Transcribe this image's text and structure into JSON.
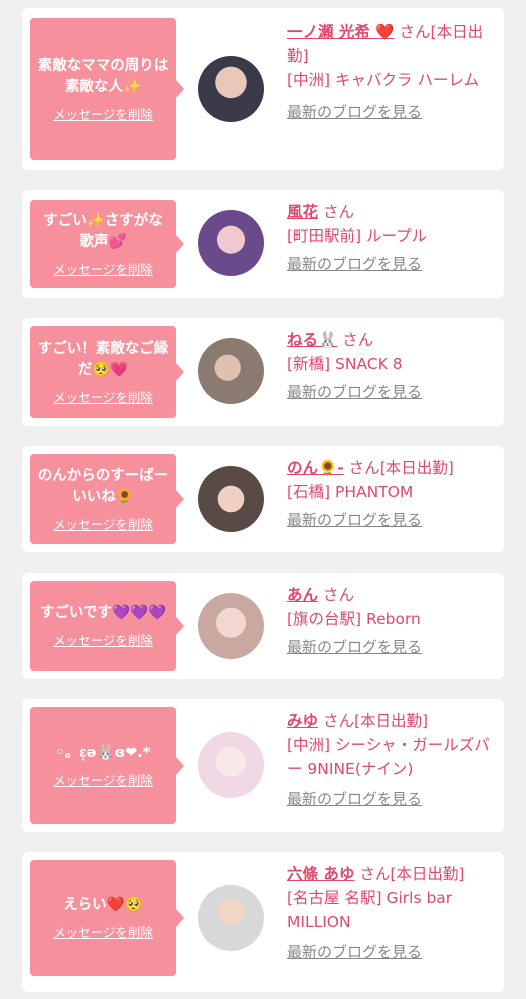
{
  "cards": [
    {
      "message": "素敵なママの周りは素敵な人✨",
      "delete_label": "メッセージを削除",
      "name": "一ノ瀬 光希 ❤️",
      "san": "さん",
      "status": "[本日出勤]",
      "shop": "[中洲] キャバクラ ハーレム",
      "blog": "最新のブログを見る"
    },
    {
      "message": "すごい✨さすがな歌声💕",
      "delete_label": "メッセージを削除",
      "name": "風花",
      "san": "さん",
      "status": "",
      "shop": "[町田駅前] ループル",
      "blog": "最新のブログを見る"
    },
    {
      "message": "すごい！素敵なご縁だ🥺💗",
      "delete_label": "メッセージを削除",
      "name": "ねる🐰",
      "san": "さん",
      "status": "",
      "shop": "[新橋] SNACK 8",
      "blog": "最新のブログを見る"
    },
    {
      "message": "のんからのすーばーいいね🌻",
      "delete_label": "メッセージを削除",
      "name": "のん🌻‐",
      "san": "さん",
      "status": "[本日出勤]",
      "shop": "[石橋] PHANTOM",
      "blog": "最新のブログを見る"
    },
    {
      "message": "すごいです💜💜💜",
      "delete_label": "メッセージを削除",
      "name": "あん",
      "san": "さん",
      "status": "",
      "shop": "[旗の台駅] Reborn",
      "blog": "最新のブログを見る"
    },
    {
      "message": "◦。ɛ͙ə🐰ɞ❤︎.*",
      "delete_label": "メッセージを削除",
      "name": "みゆ",
      "san": "さん",
      "status": "[本日出勤]",
      "shop": "[中洲] シーシャ・ガールズバー 9NINE(ナイン)",
      "blog": "最新のブログを見る"
    },
    {
      "message": "えらい❤️🥺",
      "delete_label": "メッセージを削除",
      "name": "六條 あゆ",
      "san": "さん",
      "status": "[本日出勤]",
      "shop": "[名古屋 名駅] Girls bar MILLION",
      "blog": "最新のブログを見る"
    }
  ],
  "avatar_colors": [
    "#3a3a4a",
    "#6a4a8a",
    "#8a7a70",
    "#5a4a45",
    "#c8a8a0",
    "#f0d8e4",
    "#d8d8d8"
  ]
}
